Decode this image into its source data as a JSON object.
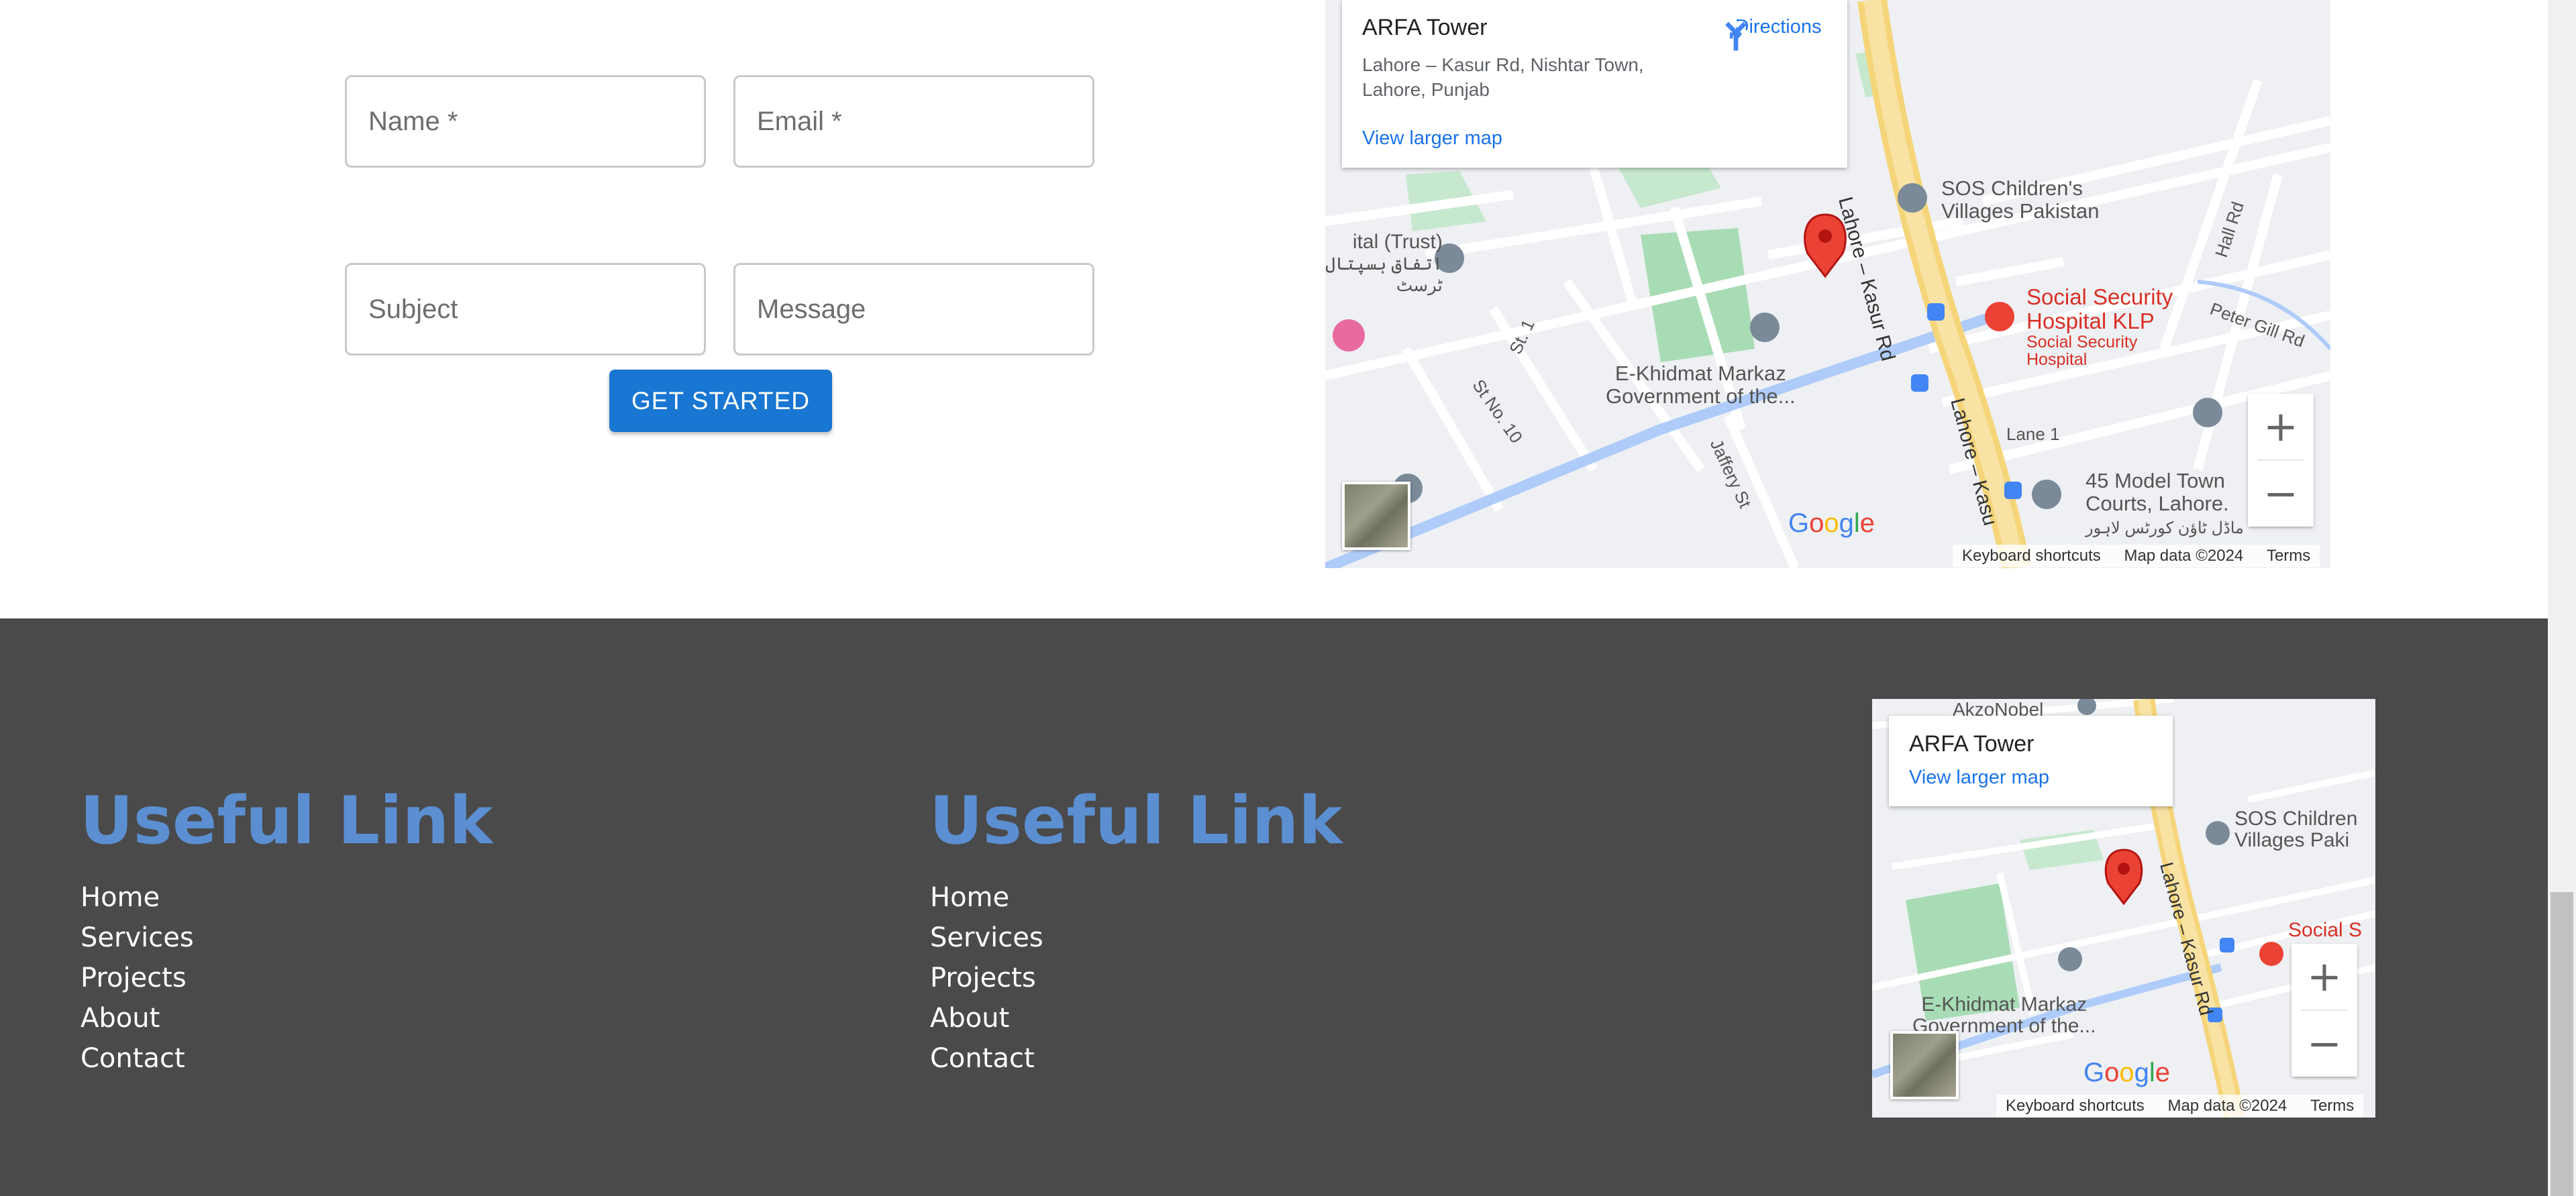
{
  "form": {
    "name_placeholder": "Name *",
    "email_placeholder": "Email *",
    "subject_placeholder": "Subject",
    "message_placeholder": "Message",
    "submit_label": "GET STARTED"
  },
  "main_map": {
    "place_name": "ARFA Tower",
    "address": "Lahore – Kasur Rd, Nishtar Town, Lahore, Punjab",
    "directions_label": "Directions",
    "larger_map_label": "View larger map",
    "keyboard_shortcuts": "Keyboard shortcuts",
    "map_data": "Map data ©2024",
    "terms": "Terms",
    "zoom_in": "+",
    "zoom_out": "−",
    "labels": {
      "sos": "SOS Children's Villages Pakistan",
      "ssh_line1": "Social Security",
      "ssh_line2": "Hospital KLP",
      "ssh_sub1": "Social Security",
      "ssh_sub2": "Hospital",
      "ekhidmat_line1": "E-Khidmat Markaz",
      "ekhidmat_line2": "Government of the...",
      "road_main": "Lahore – Kasur Rd",
      "road_main2": "Lahore – Kasu",
      "hall_rd": "Hall Rd",
      "peter_gill": "Peter Gill Rd",
      "lane1": "Lane 1",
      "st1": "St. 1",
      "st10": "St No. 10",
      "jaffery": "Jaffery St",
      "model_town_line1": "45 Model Town",
      "model_town_line2": "Courts, Lahore.",
      "model_town_urdu": "ماڈل ٹاؤن کورٹس لاہور",
      "ittefaq_line1": "ital (Trust)",
      "ittefaq_urdu1": "اتفاق ہسپتال",
      "ittefaq_urdu2": "ٹرسٹ",
      "google": "Google"
    }
  },
  "footer": {
    "columns": [
      {
        "title": "Useful Link",
        "links": [
          "Home",
          "Services",
          "Projects",
          "About",
          "Contact"
        ]
      },
      {
        "title": "Useful Link",
        "links": [
          "Home",
          "Services",
          "Projects",
          "About",
          "Contact"
        ]
      }
    ],
    "map": {
      "place_name": "ARFA Tower",
      "larger_map_label": "View larger map",
      "keyboard_shortcuts": "Keyboard shortcuts",
      "map_data": "Map data ©2024",
      "terms": "Terms",
      "zoom_in": "+",
      "zoom_out": "−",
      "labels": {
        "akzo": "AkzoNobel",
        "sos_line1": "SOS Children",
        "sos_line2": "Villages Paki",
        "social": "Social S",
        "ekhidmat_line1": "E-Khidmat Markaz",
        "ekhidmat_line2": "Government of the...",
        "road": "Lahore – Kasur Rd",
        "google": "Google"
      }
    }
  },
  "colors": {
    "accent": "#1976d2",
    "footer_bg": "#4a4a4b",
    "footer_title": "#5b8fd2",
    "marker": "#ea4335"
  }
}
